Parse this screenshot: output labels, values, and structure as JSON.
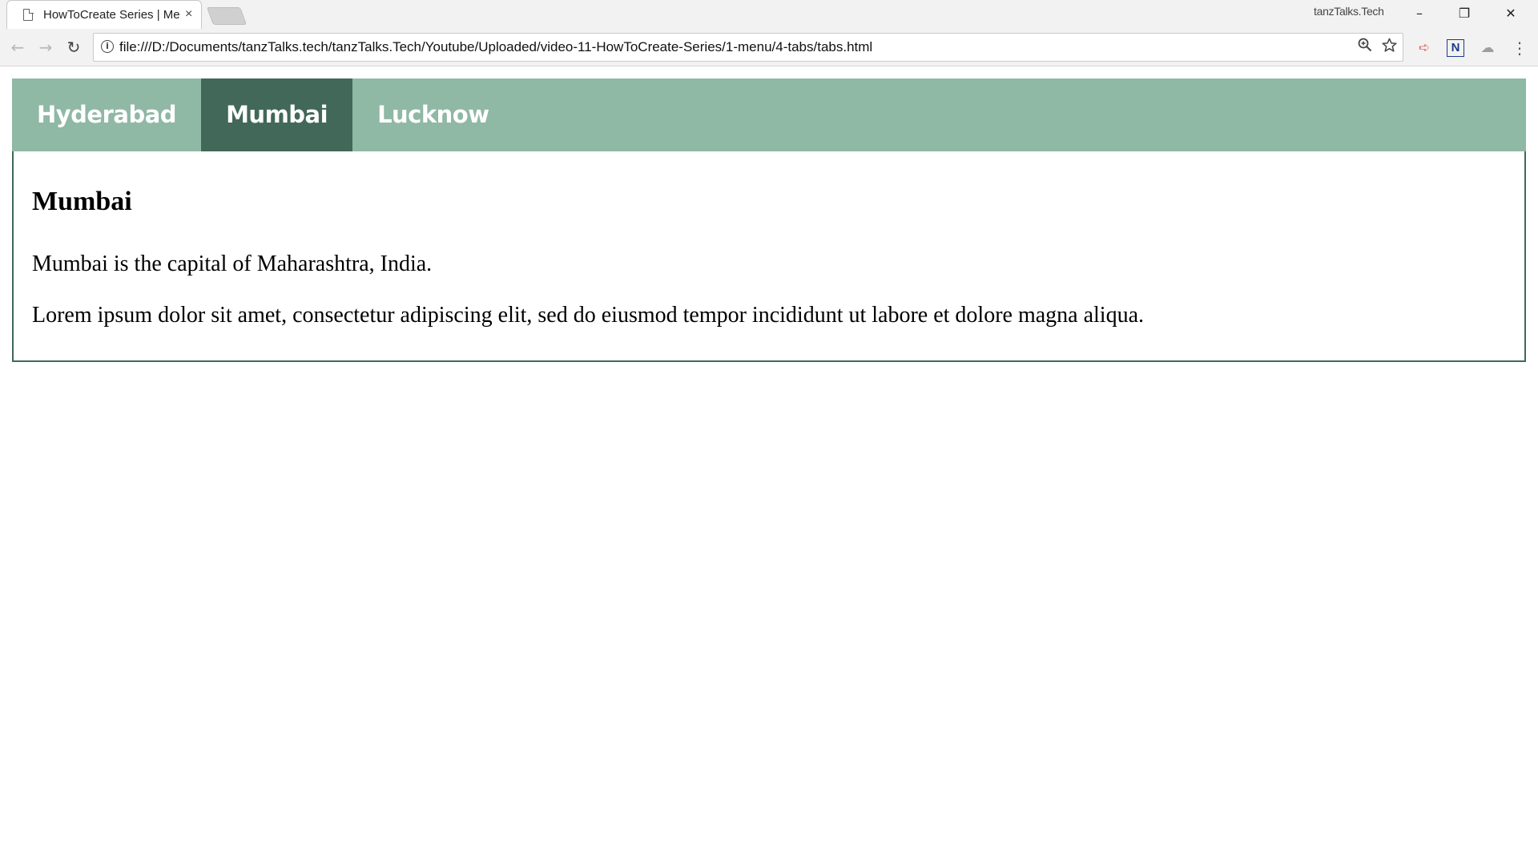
{
  "browser": {
    "tab_title": "HowToCreate Series | Me",
    "tab_close": "×",
    "profile_name": "tanzTalks.Tech",
    "window_controls": {
      "minimize": "–",
      "restore": "❐",
      "close": "✕"
    },
    "nav": {
      "back": "←",
      "forward": "→",
      "reload": "↻"
    },
    "address": {
      "info_icon": "i",
      "url": "file:///D:/Documents/tanzTalks.tech/tanzTalks.Tech/Youtube/Uploaded/video-11-HowToCreate-Series/1-menu/4-tabs/tabs.html",
      "zoom_icon": "magnifier-icon",
      "star_icon": "star-icon"
    },
    "extensions": [
      {
        "name": "red-arrow-icon",
        "glyph": "➪",
        "color": "#e57373"
      },
      {
        "name": "n-extension-icon",
        "glyph": "N",
        "color": "#1a3a8c"
      },
      {
        "name": "cloud-extension-icon",
        "glyph": "☁",
        "color": "#9e9e9e"
      }
    ],
    "menu_icon": "⋮"
  },
  "tabs": [
    {
      "label": "Hyderabad",
      "active": false
    },
    {
      "label": "Mumbai",
      "active": true
    },
    {
      "label": "Lucknow",
      "active": false
    }
  ],
  "content": {
    "heading": "Mumbai",
    "paragraph_1": "Mumbai is the capital of Maharashtra, India.",
    "paragraph_2": "Lorem ipsum dolor sit amet, consectetur adipiscing elit, sed do eiusmod tempor incididunt ut labore et dolore magna aliqua."
  },
  "colors": {
    "tab_bar": "#8fb8a5",
    "tab_active": "#416858",
    "tab_text": "#ffffff"
  }
}
